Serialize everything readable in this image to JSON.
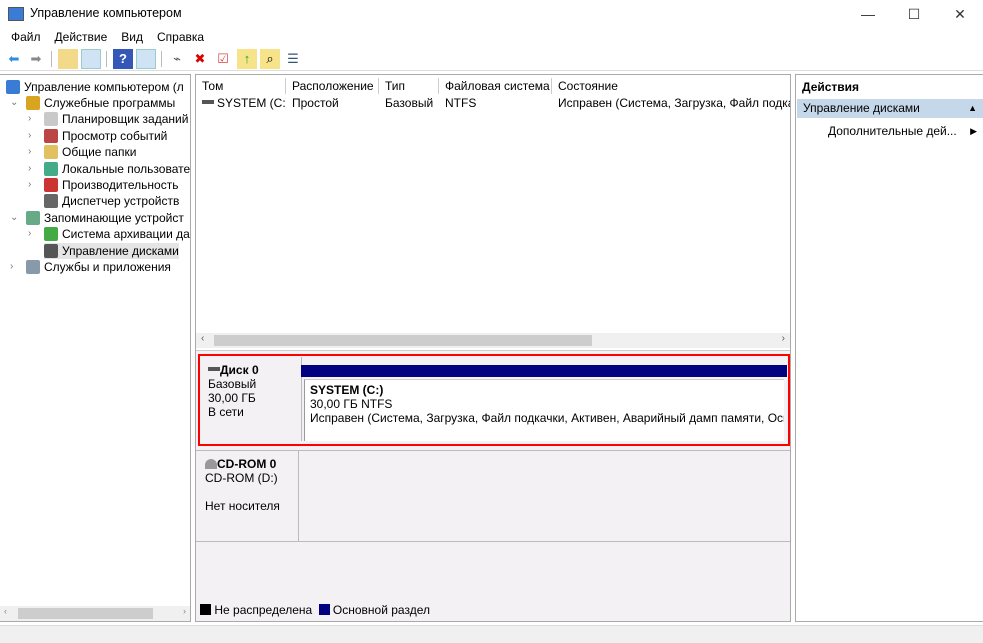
{
  "window": {
    "title": "Управление компьютером",
    "minimize": "—",
    "maximize": "☐",
    "close": "✕"
  },
  "menu": [
    "Файл",
    "Действие",
    "Вид",
    "Справка"
  ],
  "toolbar": {
    "icons": [
      "back-arrow-icon",
      "forward-arrow-icon",
      "up-folder-icon",
      "show-hide-tree-icon",
      "help-icon",
      "show-hide-action-pane-icon",
      "connect-icon",
      "delete-icon",
      "properties-icon",
      "import-icon",
      "search-icon",
      "list-icon"
    ]
  },
  "tree": {
    "root": "Управление компьютером (л",
    "items": [
      {
        "label": "Служебные программы",
        "level": 1,
        "expanded": true
      },
      {
        "label": "Планировщик заданий",
        "level": 2
      },
      {
        "label": "Просмотр событий",
        "level": 2
      },
      {
        "label": "Общие папки",
        "level": 2
      },
      {
        "label": "Локальные пользовате",
        "level": 2
      },
      {
        "label": "Производительность",
        "level": 2
      },
      {
        "label": "Диспетчер устройств",
        "level": 2,
        "leaf": true
      },
      {
        "label": "Запоминающие устройст",
        "level": 1,
        "expanded": true
      },
      {
        "label": "Система архивации да",
        "level": 2
      },
      {
        "label": "Управление дисками",
        "level": 2,
        "leaf": true,
        "selected": true
      },
      {
        "label": "Службы и приложения",
        "level": 1
      }
    ]
  },
  "volumes": {
    "columns": [
      "Том",
      "Расположение",
      "Тип",
      "Файловая система",
      "Состояние"
    ],
    "rows": [
      [
        "SYSTEM (C:)",
        "Простой",
        "Базовый",
        "NTFS",
        "Исправен (Система, Загрузка, Файл подка"
      ]
    ]
  },
  "disks": [
    {
      "name": "Диск 0",
      "type": "Базовый",
      "size": "30,00 ГБ",
      "status": "В сети",
      "partition": {
        "name": "SYSTEM  (C:)",
        "size": "30,00 ГБ NTFS",
        "status": "Исправен (Система, Загрузка, Файл подкачки, Активен, Аварийный дамп памяти, Осн"
      }
    },
    {
      "name": "CD-ROM 0",
      "type": "CD-ROM (D:)",
      "status": "Нет носителя"
    }
  ],
  "legend": [
    {
      "label": "Не распределена",
      "color": "#000000"
    },
    {
      "label": "Основной раздел",
      "color": "#000080"
    }
  ],
  "actions": {
    "title": "Действия",
    "section": "Управление дисками",
    "item": "Дополнительные дей..."
  },
  "colors": {
    "primary_partition": "#000080",
    "highlight": "#ff0000",
    "action_header": "#c5d8ea"
  }
}
